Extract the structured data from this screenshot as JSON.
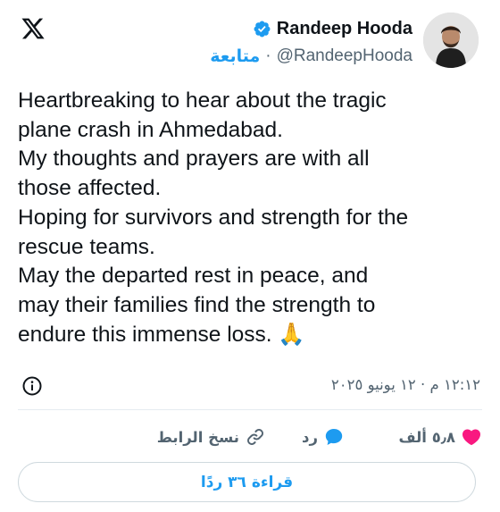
{
  "header": {
    "logo_icon": "x-logo-icon",
    "display_name": "Randeep Hooda",
    "verified_icon": "verified-badge-icon",
    "verified_color": "#1d9bf0",
    "handle": "@RandeepHooda",
    "separator": "·",
    "follow_label": "متابعة",
    "avatar_icon": "profile-avatar"
  },
  "tweet": {
    "text": "Heartbreaking to hear about the tragic\nplane crash in Ahmedabad.\nMy thoughts and prayers are with all\nthose affected.\nHoping for survivors and strength for the\nrescue teams.\nMay the departed rest in peace, and\nmay their families find the strength to\nendure this immense loss. 🙏"
  },
  "meta": {
    "timestamp": "١٢:١٢ م · ١٢ يونيو ٢٠٢٥",
    "info_icon": "info-icon"
  },
  "actions": {
    "likes_label": "٥٫٨ ألف",
    "like_icon": "heart-icon",
    "like_color": "#f91880",
    "reply_label": "رد",
    "reply_icon": "speech-bubble-icon",
    "reply_color": "#1d9bf0",
    "copy_link_label": "نسخ الرابط",
    "copy_link_icon": "link-icon"
  },
  "read_replies": {
    "label": "قراءة ٣٦ ردًا"
  }
}
